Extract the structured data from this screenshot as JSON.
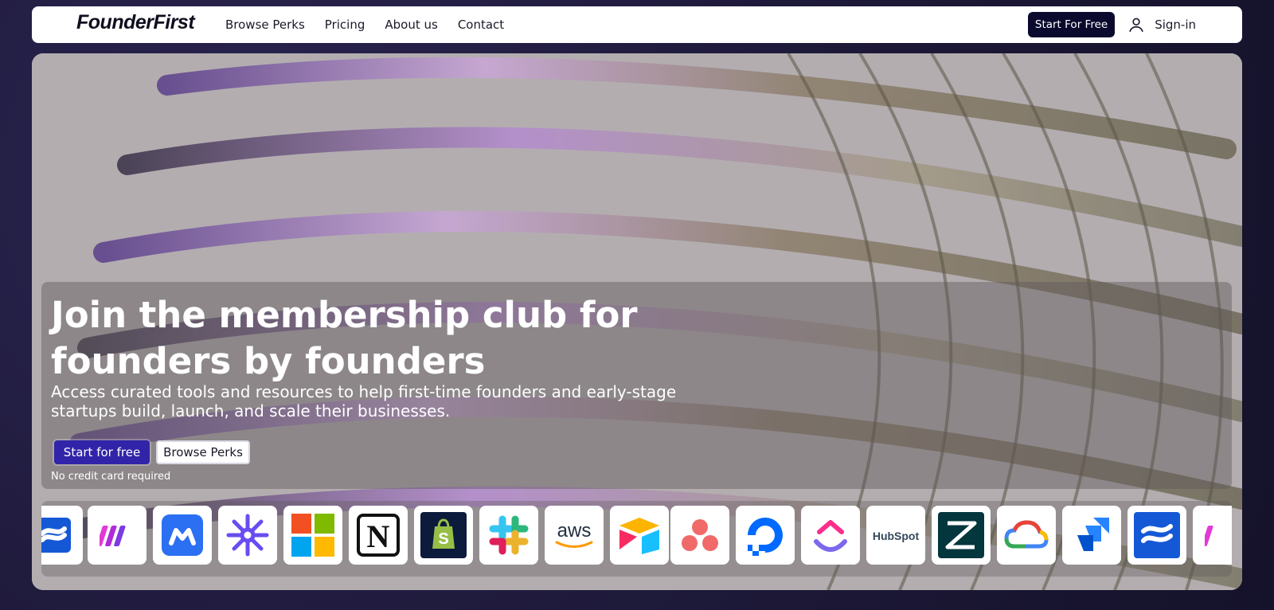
{
  "nav": {
    "logo": "FounderFirst",
    "links": [
      "Browse Perks",
      "Pricing",
      "About us",
      "Contact"
    ],
    "start_label": "Start For Free",
    "signin_label": "Sign-in"
  },
  "hero": {
    "headline_line1": "Join the membership club for",
    "headline_line2": "founders by founders",
    "subtext_line1": "Access curated tools and resources to help first-time founders and early-stage",
    "subtext_line2": "startups build, launch, and scale their businesses.",
    "primary_cta": "Start for free",
    "secondary_cta": "Browse Perks",
    "note": "No credit card required"
  },
  "logos": {
    "aws_text": "aws",
    "hubspot_text": "HubSpot",
    "notion_text": "N",
    "items": [
      "confluence-icon",
      "make-icon",
      "monday-icon",
      "perplexity-icon",
      "microsoft-icon",
      "notion-icon",
      "shopify-icon",
      "slack-icon",
      "aws-icon",
      "airtable-icon",
      "asana-icon",
      "digitalocean-icon",
      "clickup-icon",
      "hubspot-icon",
      "zendesk-icon",
      "google-cloud-icon",
      "jira-icon",
      "confluence-icon",
      "make-icon"
    ]
  },
  "colors": {
    "nav_cta_bg": "#0b0a2e",
    "primary_cta_bg": "#3124a8",
    "page_bg": "#1e1a3a"
  }
}
